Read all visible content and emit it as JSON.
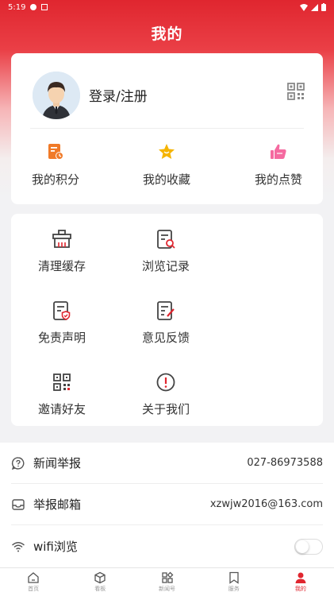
{
  "status_bar": {
    "time": "5:19"
  },
  "header": {
    "title": "我的"
  },
  "profile": {
    "login_label": "登录/注册",
    "stats": [
      {
        "label": "我的积分",
        "icon": "points-icon"
      },
      {
        "label": "我的收藏",
        "icon": "star-icon"
      },
      {
        "label": "我的点赞",
        "icon": "thumbs-up-icon"
      }
    ]
  },
  "tools": [
    {
      "label": "清理缓存",
      "icon": "broom-icon"
    },
    {
      "label": "浏览记录",
      "icon": "history-icon"
    },
    {
      "label": "免责声明",
      "icon": "disclaimer-icon"
    },
    {
      "label": "意见反馈",
      "icon": "feedback-icon"
    },
    {
      "label": "邀请好友",
      "icon": "qr-code-icon"
    },
    {
      "label": "关于我们",
      "icon": "info-icon"
    }
  ],
  "settings": {
    "report": {
      "label": "新闻举报",
      "value": "027-86973588"
    },
    "email": {
      "label": "举报邮箱",
      "value": "xzwjw2016@163.com"
    },
    "wifi": {
      "label": "wifi浏览",
      "enabled": false
    }
  },
  "tabs": [
    {
      "label": "首页"
    },
    {
      "label": "看板"
    },
    {
      "label": "新闻号"
    },
    {
      "label": "服务"
    },
    {
      "label": "我的",
      "active": true
    }
  ],
  "colors": {
    "accent": "#e0262f",
    "orange": "#f07a28",
    "gold": "#f5b400",
    "pink": "#f56aa0"
  }
}
